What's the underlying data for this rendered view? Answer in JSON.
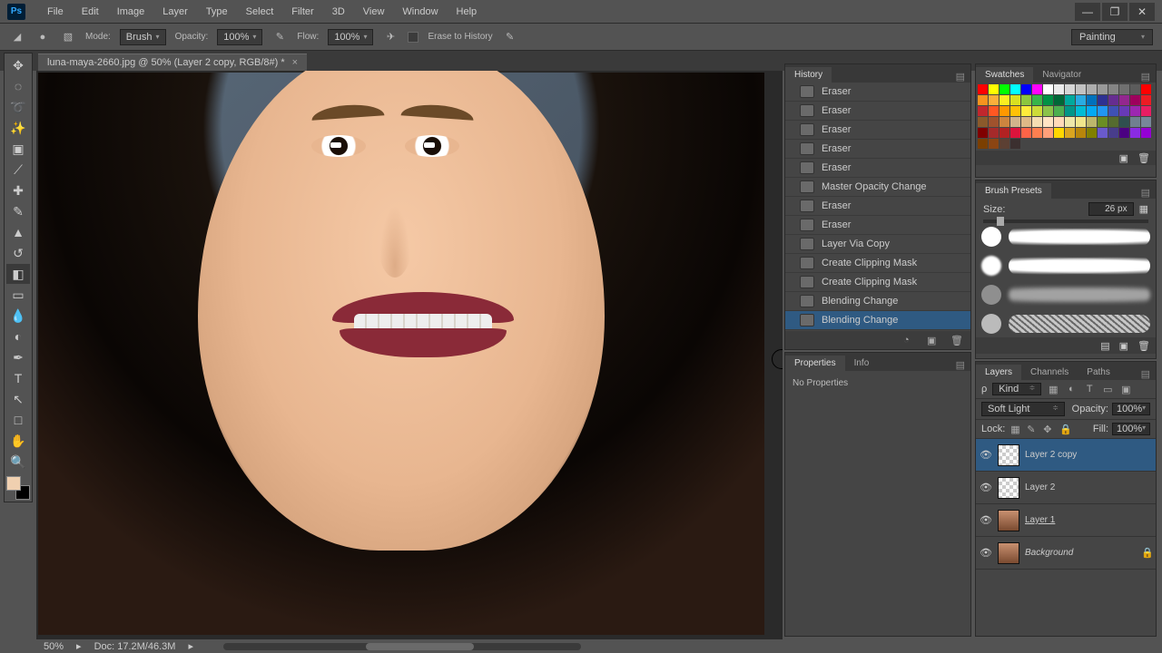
{
  "menu": {
    "items": [
      "File",
      "Edit",
      "Image",
      "Layer",
      "Type",
      "Select",
      "Filter",
      "3D",
      "View",
      "Window",
      "Help"
    ]
  },
  "window_controls": {
    "min": "—",
    "max": "❐",
    "close": "✕"
  },
  "options_bar": {
    "mode_label": "Mode:",
    "mode_value": "Brush",
    "opacity_label": "Opacity:",
    "opacity_value": "100%",
    "flow_label": "Flow:",
    "flow_value": "100%",
    "erase_label": "Erase to History",
    "workspace": "Painting"
  },
  "document_tab": "luna-maya-2660.jpg @ 50% (Layer 2 copy, RGB/8#) *",
  "status": {
    "zoom": "50%",
    "doc": "Doc: 17.2M/46.3M"
  },
  "history": {
    "tab": "History",
    "items": [
      {
        "label": "Eraser"
      },
      {
        "label": "Eraser"
      },
      {
        "label": "Eraser"
      },
      {
        "label": "Eraser"
      },
      {
        "label": "Eraser"
      },
      {
        "label": "Master Opacity Change"
      },
      {
        "label": "Eraser"
      },
      {
        "label": "Eraser"
      },
      {
        "label": "Layer Via Copy"
      },
      {
        "label": "Create Clipping Mask"
      },
      {
        "label": "Create Clipping Mask"
      },
      {
        "label": "Blending Change"
      },
      {
        "label": "Blending Change"
      }
    ],
    "selected_index": 12
  },
  "properties": {
    "tabs": [
      "Properties",
      "Info"
    ],
    "body": "No Properties"
  },
  "swatches": {
    "tabs": [
      "Swatches",
      "Navigator"
    ],
    "colors": [
      "#ff0000",
      "#ffff00",
      "#00ff00",
      "#00ffff",
      "#0000ff",
      "#ff00ff",
      "#ffffff",
      "#ebebeb",
      "#d6d6d6",
      "#c2c2c2",
      "#adadad",
      "#999999",
      "#858585",
      "#707070",
      "#5c5c5c",
      "#ff0000",
      "#f7931e",
      "#fbb03b",
      "#fcee21",
      "#d9e021",
      "#8cc63f",
      "#39b54a",
      "#009245",
      "#006837",
      "#00a99d",
      "#29abe2",
      "#0071bc",
      "#2e3192",
      "#662d91",
      "#93278f",
      "#9e005d",
      "#ed1c24",
      "#c1272d",
      "#ff5722",
      "#ff9800",
      "#ffc107",
      "#ffeb3b",
      "#cddc39",
      "#8bc34a",
      "#4caf50",
      "#009688",
      "#00bcd4",
      "#03a9f4",
      "#2196f3",
      "#3f51b5",
      "#673ab7",
      "#9c27b0",
      "#e91e63",
      "#8b5a2b",
      "#a0522d",
      "#cd853f",
      "#d2b48c",
      "#deb887",
      "#f5deb3",
      "#ffe4c4",
      "#ffdab9",
      "#eee8aa",
      "#f0e68c",
      "#bdb76b",
      "#6b8e23",
      "#556b2f",
      "#2f4f4f",
      "#708090",
      "#778899",
      "#800000",
      "#a52a2a",
      "#b22222",
      "#dc143c",
      "#ff6347",
      "#ff7f50",
      "#ffa07a",
      "#ffd700",
      "#daa520",
      "#b8860b",
      "#808000",
      "#6a5acd",
      "#483d8b",
      "#4b0082",
      "#8a2be2",
      "#9400d3",
      "#7b3f00",
      "#8b4513",
      "#5c4033",
      "#3b2f2f"
    ]
  },
  "brush_presets": {
    "tab": "Brush Presets",
    "size_label": "Size:",
    "size_value": "26 px"
  },
  "layers": {
    "tabs": [
      "Layers",
      "Channels",
      "Paths"
    ],
    "kind_label": "Kind",
    "blend_mode": "Soft Light",
    "opacity_label": "Opacity:",
    "opacity_value": "100%",
    "lock_label": "Lock:",
    "fill_label": "Fill:",
    "fill_value": "100%",
    "items": [
      {
        "name": "Layer 2 copy",
        "thumb": "chk",
        "selected": true
      },
      {
        "name": "Layer 2",
        "thumb": "chk"
      },
      {
        "name": "Layer 1",
        "thumb": "photo",
        "underline": true
      },
      {
        "name": "Background",
        "thumb": "photo",
        "locked": true,
        "italic": true
      }
    ]
  },
  "tools": [
    "move",
    "marquee",
    "lasso",
    "wand",
    "crop",
    "eyedropper",
    "heal",
    "brush",
    "stamp",
    "history-brush",
    "eraser",
    "gradient",
    "blur",
    "dodge",
    "pen",
    "type",
    "path",
    "shape",
    "hand",
    "zoom"
  ]
}
